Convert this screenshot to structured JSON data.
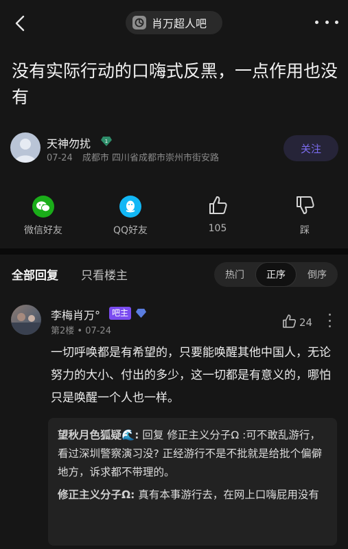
{
  "topbar": {
    "forum_name": "肖万超人吧"
  },
  "post": {
    "title": "没有实际行动的口嗨式反黑，一点作用也没有",
    "author": {
      "name": "天神勿扰",
      "date": "07-24",
      "location": "成都市 四川省成都市崇州市街安路",
      "follow_label": "关注"
    }
  },
  "actions": [
    {
      "label": "微信好友",
      "icon": "wechat-icon"
    },
    {
      "label": "QQ好友",
      "icon": "qq-icon"
    },
    {
      "label": "105",
      "icon": "thumbs-up-icon"
    },
    {
      "label": "踩",
      "icon": "thumbs-down-icon"
    }
  ],
  "tabs": {
    "all": "全部回复",
    "op_only": "只看楼主",
    "sort": [
      "热门",
      "正序",
      "倒序"
    ],
    "sort_active": "正序"
  },
  "reply": {
    "name": "李梅肖万°",
    "admin_badge": "吧主",
    "floor": "第2楼 • 07-24",
    "likes": "24",
    "text": "一切呼唤都是有希望的，只要能唤醒其他中国人，无论努力的大小、付出的多少，这一切都是有意义的，哪怕只是唤醒一个人也一样。",
    "subreplies": [
      {
        "who": "望秋月色狐疑🌊:",
        "text": " 回复 修正主义分子Ω :可不敢乱游行，看过深圳警察演习没? 正经游行不是不批就是给批个偏僻地方，诉求都不带理的。"
      },
      {
        "who": "修正主义分子Ω:",
        "text": " 真有本事游行去，在网上口嗨屁用没有"
      }
    ]
  },
  "colors": {
    "background": "#161616",
    "accent": "#7c6cf0",
    "admin_badge": "#7a4cf0",
    "wechat_green": "#1aad19",
    "qq_blue": "#12b7f5"
  }
}
